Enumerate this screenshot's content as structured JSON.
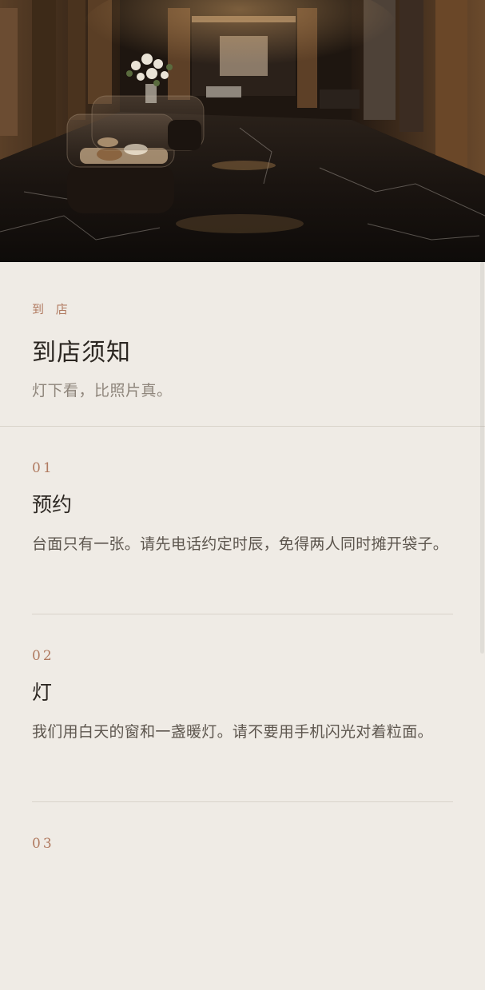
{
  "hero": {
    "image_icon": "boutique-interior-photo"
  },
  "intro": {
    "kicker": "到 店",
    "title": "到店须知",
    "subtitle": "灯下看，比照片真。"
  },
  "notices": [
    {
      "number": "01",
      "heading": "预约",
      "body": "台面只有一张。请先电话约定时辰，免得两人同时摊开袋子。"
    },
    {
      "number": "02",
      "heading": "灯",
      "body": "我们用白天的窗和一盏暖灯。请不要用手机闪光对着粒面。"
    },
    {
      "number": "03",
      "heading": "",
      "body": ""
    }
  ],
  "colors": {
    "background": "#efebe5",
    "accent": "#b07a60",
    "text": "#2c2722",
    "muted": "#8e857b"
  }
}
